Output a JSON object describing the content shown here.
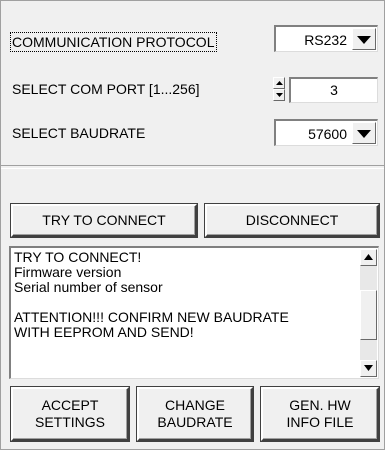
{
  "settings": {
    "protocol_label": "COMMUNICATION PROTOCOL",
    "protocol_value": "RS232",
    "comport_label": "SELECT COM PORT [1...256]",
    "comport_value": "3",
    "baudrate_label": "SELECT BAUDRATE",
    "baudrate_value": "57600"
  },
  "connection": {
    "connect_label": "TRY TO CONNECT",
    "disconnect_label": "DISCONNECT"
  },
  "log": {
    "lines": [
      "TRY TO CONNECT!",
      "Firmware version",
      "Serial number of sensor",
      "",
      "ATTENTION!!!  CONFIRM NEW BAUDRATE",
      "WITH EEPROM AND SEND!"
    ],
    "scroll_position": 0.55
  },
  "actions": {
    "accept_line1": "ACCEPT",
    "accept_line2": "SETTINGS",
    "change_line1": "CHANGE",
    "change_line2": "BAUDRATE",
    "genhw_line1": "GEN. HW",
    "genhw_line2": "INFO FILE"
  },
  "icons": {
    "dropdown": "triangle-down-icon",
    "spin_up": "triangle-up-icon",
    "spin_down": "triangle-down-icon",
    "scroll_up": "triangle-up-icon",
    "scroll_down": "triangle-down-icon"
  }
}
